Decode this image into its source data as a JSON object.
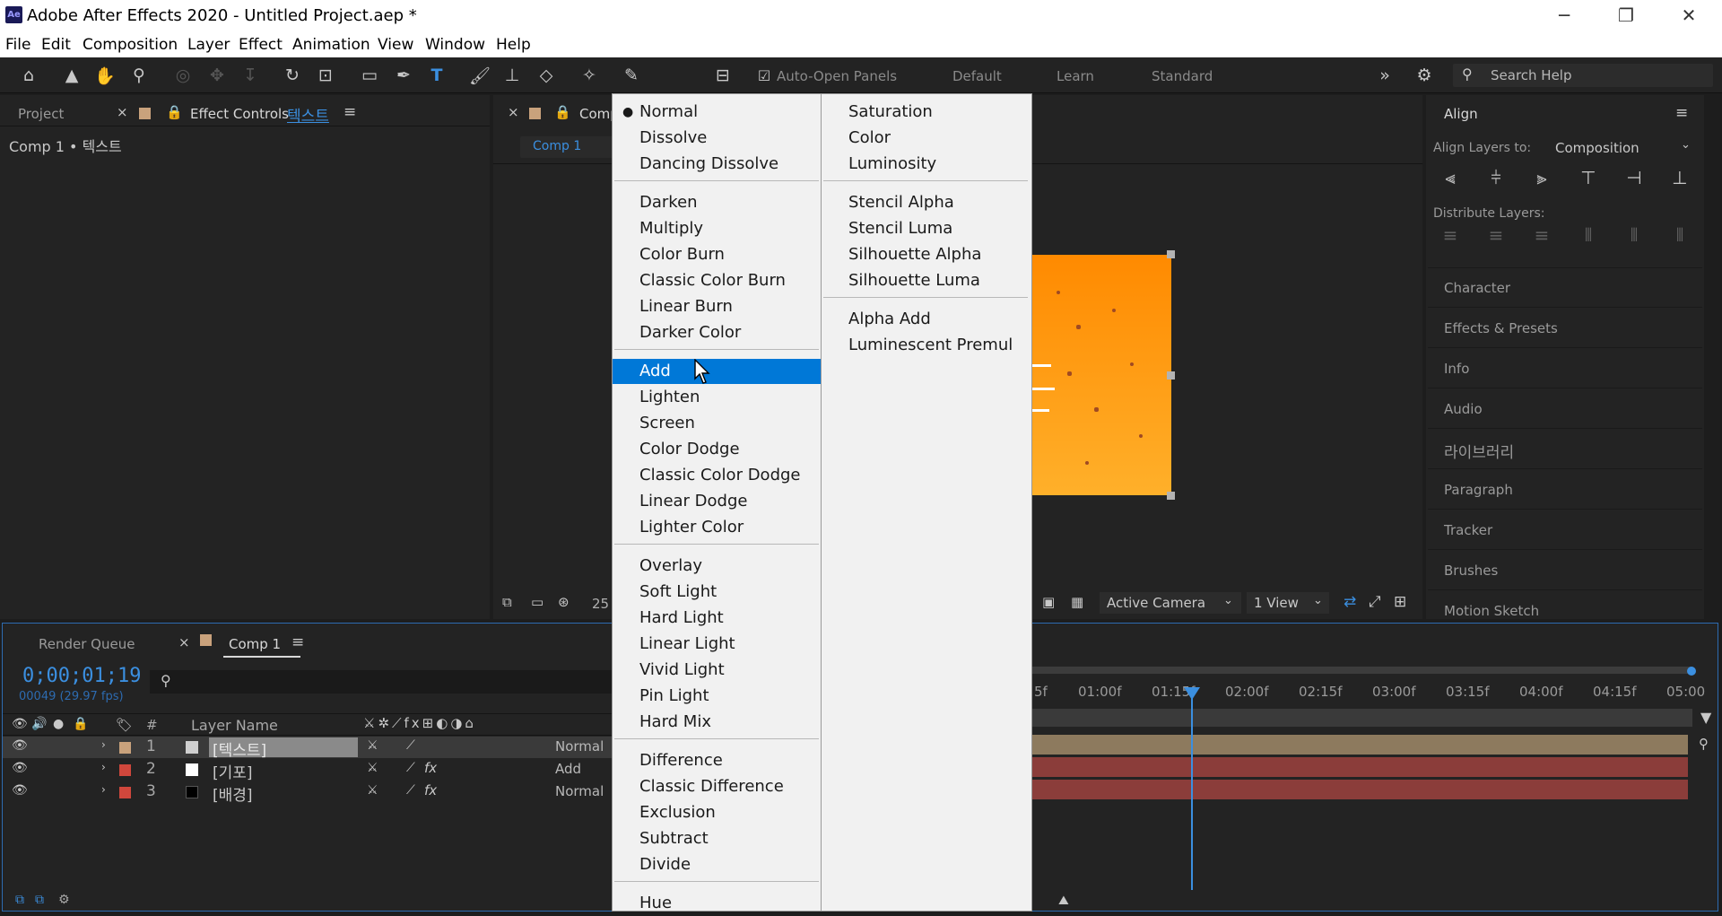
{
  "window": {
    "title": "Adobe After Effects 2020 - Untitled Project.aep *",
    "logo": "Ae",
    "controls": {
      "minimize": "─",
      "restore": "❐",
      "close": "✕"
    }
  },
  "menubar": [
    "File",
    "Edit",
    "Composition",
    "Layer",
    "Effect",
    "Animation",
    "View",
    "Window",
    "Help"
  ],
  "toolbar": {
    "auto_open_label": "Auto-Open Panels",
    "workspaces": [
      "Default",
      "Learn",
      "Standard"
    ],
    "search_placeholder": "Search Help",
    "expand": "»"
  },
  "project_panel": {
    "tab_project": "Project",
    "tab_effect_controls": "Effect Controls",
    "effect_controls_layer": "텍스트",
    "breadcrumb": "Comp 1 • 텍스트"
  },
  "comp_panel": {
    "tab": "Comp",
    "sub_tab": "Comp 1",
    "zoom": "25",
    "camera": "Active Camera",
    "view": "1 View"
  },
  "blend_menu_col1": [
    {
      "label": "Normal",
      "checked": true
    },
    {
      "label": "Dissolve"
    },
    {
      "label": "Dancing Dissolve"
    },
    {
      "sep": true
    },
    {
      "label": "Darken"
    },
    {
      "label": "Multiply"
    },
    {
      "label": "Color Burn"
    },
    {
      "label": "Classic Color Burn"
    },
    {
      "label": "Linear Burn"
    },
    {
      "label": "Darker Color"
    },
    {
      "sep": true
    },
    {
      "label": "Add",
      "selected": true
    },
    {
      "label": "Lighten"
    },
    {
      "label": "Screen"
    },
    {
      "label": "Color Dodge"
    },
    {
      "label": "Classic Color Dodge"
    },
    {
      "label": "Linear Dodge"
    },
    {
      "label": "Lighter Color"
    },
    {
      "sep": true
    },
    {
      "label": "Overlay"
    },
    {
      "label": "Soft Light"
    },
    {
      "label": "Hard Light"
    },
    {
      "label": "Linear Light"
    },
    {
      "label": "Vivid Light"
    },
    {
      "label": "Pin Light"
    },
    {
      "label": "Hard Mix"
    },
    {
      "sep": true
    },
    {
      "label": "Difference"
    },
    {
      "label": "Classic Difference"
    },
    {
      "label": "Exclusion"
    },
    {
      "label": "Subtract"
    },
    {
      "label": "Divide"
    },
    {
      "sep": true
    },
    {
      "label": "Hue"
    }
  ],
  "blend_menu_col2": [
    {
      "label": "Saturation"
    },
    {
      "label": "Color"
    },
    {
      "label": "Luminosity"
    },
    {
      "sep": true
    },
    {
      "label": "Stencil Alpha"
    },
    {
      "label": "Stencil Luma"
    },
    {
      "label": "Silhouette Alpha"
    },
    {
      "label": "Silhouette Luma"
    },
    {
      "sep": true
    },
    {
      "label": "Alpha Add"
    },
    {
      "label": "Luminescent Premul"
    }
  ],
  "align_panel": {
    "title": "Align",
    "align_layers_to": "Align Layers to:",
    "target": "Composition",
    "distribute": "Distribute Layers:"
  },
  "right_panels": [
    "Character",
    "Effects & Presets",
    "Info",
    "Audio",
    "라이브러리",
    "Paragraph",
    "Tracker",
    "Brushes",
    "Motion Sketch"
  ],
  "timeline": {
    "tab_render": "Render Queue",
    "tab_comp": "Comp 1",
    "timecode": "0;00;01;19",
    "frames": "00049 (29.97 fps)",
    "col_number": "#",
    "col_layer_name": "Layer Name",
    "layers": [
      {
        "num": "1",
        "name": "[텍스트]",
        "mode": "Normal",
        "label_color": "#c9a27c",
        "swatch": "#ffffff",
        "selected": true
      },
      {
        "num": "2",
        "name": "[기포]",
        "mode": "Add",
        "label_color": "#d0473c",
        "swatch": "#ffffff"
      },
      {
        "num": "3",
        "name": "[배경]",
        "mode": "Normal",
        "label_color": "#d0473c",
        "swatch": "#000000"
      }
    ],
    "ruler": [
      "5f",
      "01:00f",
      "01:15f",
      "02:00f",
      "02:15f",
      "03:00f",
      "03:15f",
      "04:00f",
      "04:15f",
      "05:00"
    ]
  },
  "colors": {
    "accent": "#0078d7",
    "timecode": "#3b8fe0",
    "orange_top": "#ff8a00",
    "orange_bottom": "#ffb02a"
  }
}
